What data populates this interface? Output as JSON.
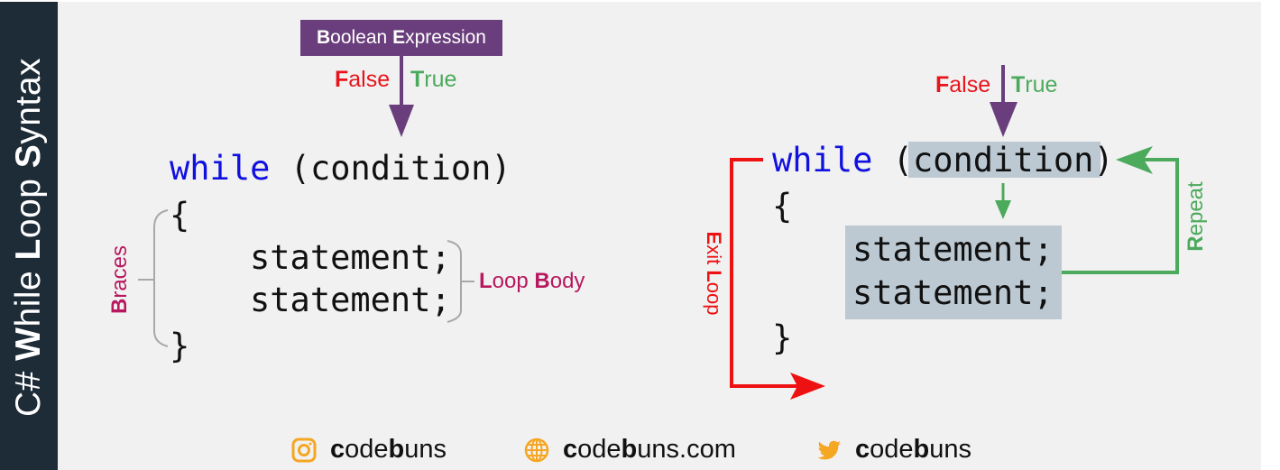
{
  "title": {
    "parts": [
      {
        "text": "C# ",
        "bold": false
      },
      {
        "text": "W",
        "bold": true
      },
      {
        "text": "hile ",
        "bold": false
      },
      {
        "text": "L",
        "bold": true
      },
      {
        "text": "oop ",
        "bold": false
      },
      {
        "text": "S",
        "bold": true
      },
      {
        "text": "yntax",
        "bold": false
      }
    ],
    "full": "C# While Loop Syntax"
  },
  "colors": {
    "sidebar": "#1e2c38",
    "background": "#f1f1f1",
    "keyword": "#1010e0",
    "boolean_box": "#6a3e7c",
    "false": "#e8141c",
    "true": "#4caa5c",
    "annotation": "#b8185e",
    "highlight": "#bcc9d2",
    "brand_icon": "#f5a623"
  },
  "left_diagram": {
    "boolean_box": {
      "first": "B",
      "rest1": "oolean ",
      "second": "E",
      "rest2": "xpression"
    },
    "false_label": {
      "first": "F",
      "rest": "alse"
    },
    "true_label": {
      "first": "T",
      "rest": "rue"
    },
    "code": {
      "keyword": "while",
      "condition": " (condition)",
      "open_brace": "{",
      "statement1": "statement;",
      "statement2": "statement;",
      "close_brace": "}"
    },
    "braces_label": {
      "first": "B",
      "rest": "races"
    },
    "loop_body_label": {
      "first1": "L",
      "rest1": "oop ",
      "first2": "B",
      "rest2": "ody"
    }
  },
  "right_diagram": {
    "false_label": {
      "first": "F",
      "rest": "alse"
    },
    "true_label": {
      "first": "T",
      "rest": "rue"
    },
    "code": {
      "keyword": "while",
      "open_paren": " (",
      "condition": "condition",
      "close_paren": ")",
      "open_brace": "{",
      "statement1": "statement;",
      "statement2": "statement;",
      "close_brace": "}"
    },
    "exit_label": {
      "first1": "E",
      "rest1": "xit ",
      "first2": "L",
      "rest2": "oop"
    },
    "repeat_label": {
      "first": "R",
      "rest": "epeat"
    }
  },
  "footer": [
    {
      "icon": "instagram-icon",
      "bold": "c",
      "text1": "ode",
      "bold2": "b",
      "text2": "uns"
    },
    {
      "icon": "globe-icon",
      "bold": "c",
      "text1": "ode",
      "bold2": "b",
      "text2": "uns.com"
    },
    {
      "icon": "twitter-icon",
      "bold": "c",
      "text1": "ode",
      "bold2": "b",
      "text2": "uns"
    }
  ]
}
